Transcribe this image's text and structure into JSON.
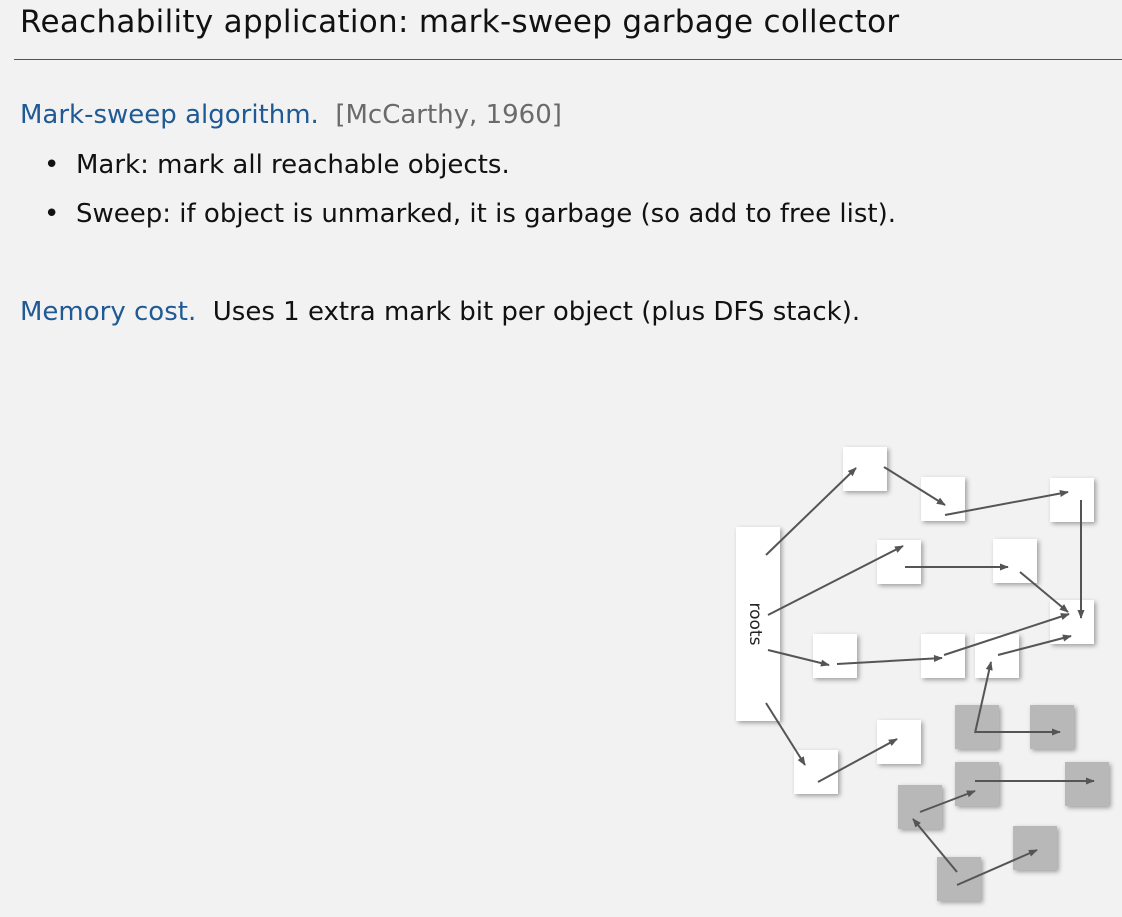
{
  "slide": {
    "title": "Reachability application:  mark-sweep garbage collector"
  },
  "mark_sweep": {
    "heading": "Mark-sweep algorithm.",
    "citation": "[McCarthy, 1960]",
    "bullets": [
      {
        "marker": "•",
        "text": "Mark:  mark all reachable objects."
      },
      {
        "marker": "•",
        "text": "Sweep:  if object is unmarked, it is garbage (so add to free list)."
      }
    ]
  },
  "memory_cost": {
    "heading": "Memory cost.",
    "text": "Uses 1 extra mark bit per object (plus DFS stack)."
  },
  "diagram": {
    "roots_label": "roots",
    "colors": {
      "reachable": "#ffffff",
      "garbage": "#b8b8b8",
      "arrow": "#555555"
    }
  }
}
